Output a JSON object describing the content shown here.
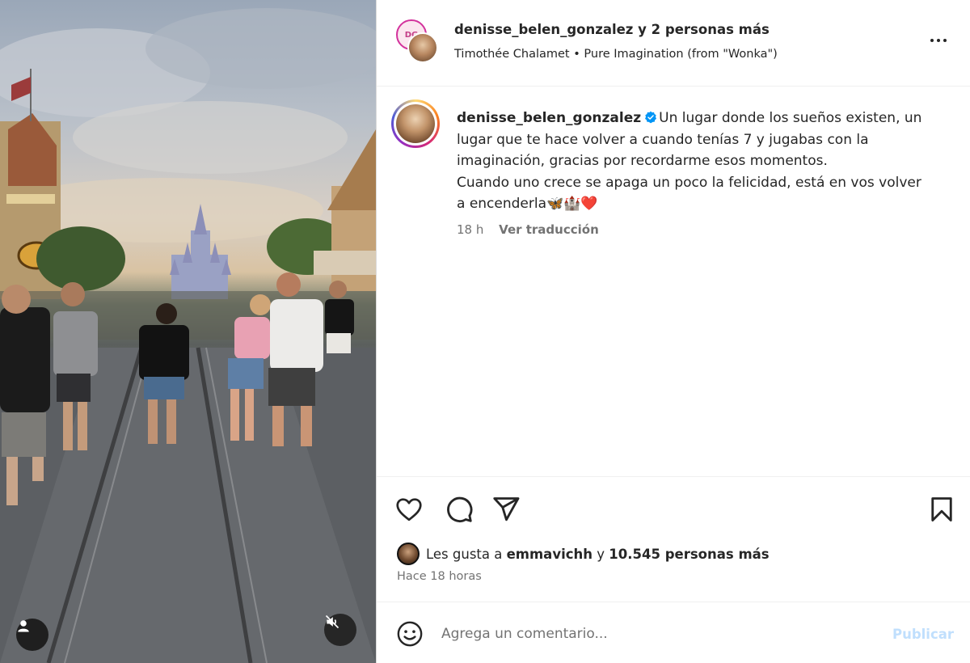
{
  "media": {
    "avatar_button_icon": "user-icon",
    "mute_button_icon": "speaker-muted-icon"
  },
  "header": {
    "username": "denisse_belen_gonzalez",
    "collab_suffix": "y 2 personas más",
    "artist": "Timothée Chalamet",
    "separator": "•",
    "song": "Pure Imagination (from \"Wonka\")",
    "more_icon": "more-horizontal-icon"
  },
  "caption": {
    "username": "denisse_belen_gonzalez",
    "verified_icon": "verified-badge-icon",
    "text_line_1": "Un lugar donde los sueños existen, un lugar que te hace volver a cuando tenías 7 y jugabas con la imaginación, gracias por recordarme esos momentos.",
    "text_line_2": "Cuando uno crece se apaga un poco la felicidad, está en vos volver a encenderla🦋🏰❤️",
    "time": "18 h",
    "translate_label": "Ver traducción"
  },
  "actions": {
    "like_icon": "heart-icon",
    "comment_icon": "comment-icon",
    "share_icon": "send-icon",
    "save_icon": "bookmark-icon"
  },
  "likes": {
    "prefix": "Les gusta a",
    "user": "emmavichh",
    "connector": "y",
    "count_text": "10.545 personas más"
  },
  "posted_ago": "Hace 18 horas",
  "comment": {
    "emoji_icon": "emoji-icon",
    "placeholder": "Agrega un comentario...",
    "publish_label": "Publicar"
  },
  "colors": {
    "verified_blue": "#0095f6",
    "publish_disabled": "#c0dffd",
    "secondary_text": "#737373"
  }
}
